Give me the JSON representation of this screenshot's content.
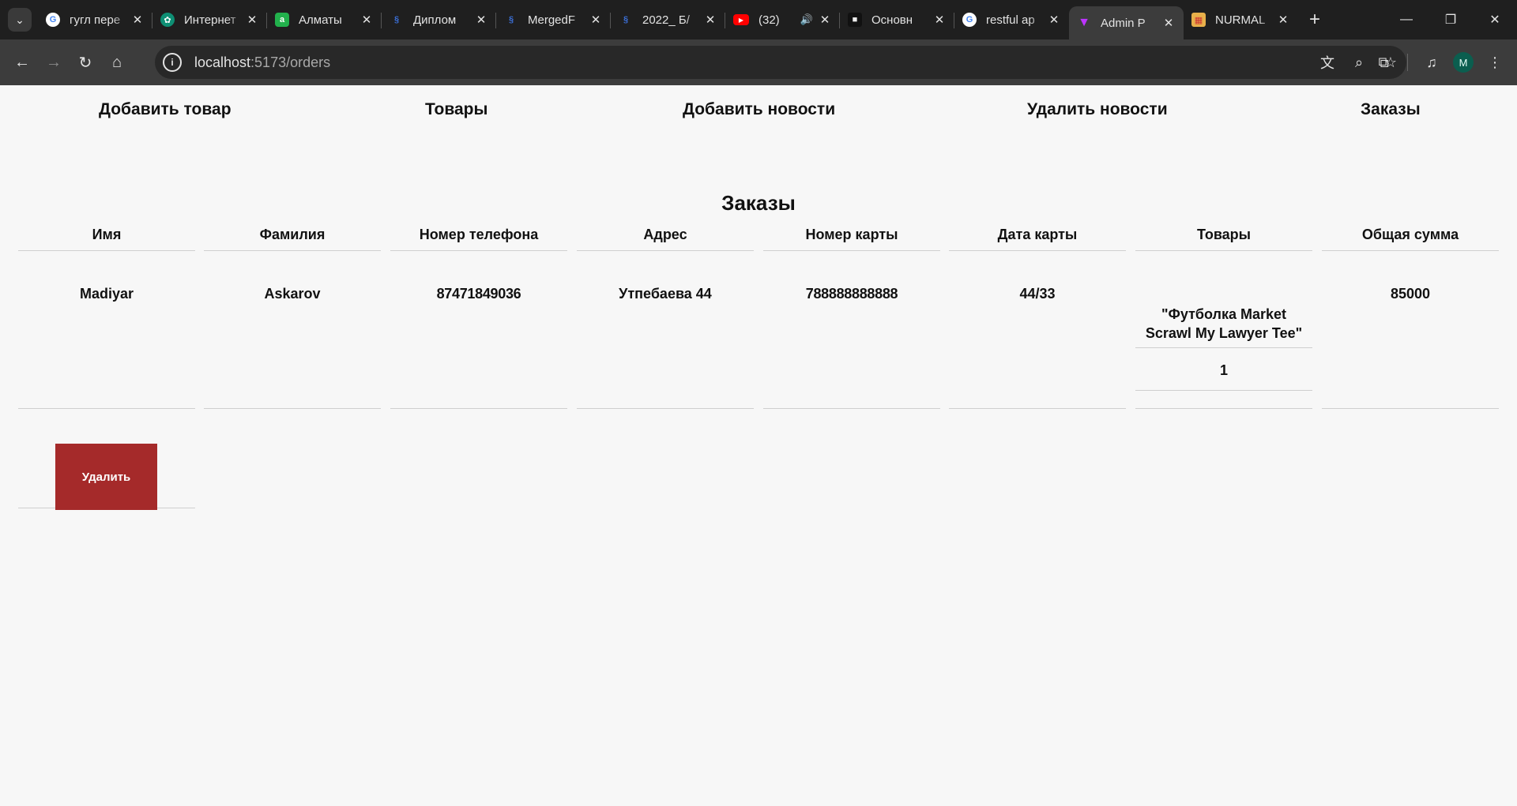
{
  "browser": {
    "tabs": [
      {
        "title": "гугл пере",
        "icon": "google-icon",
        "active": false
      },
      {
        "title": "Интернет",
        "icon": "chatgpt-icon",
        "active": false
      },
      {
        "title": "Алматы",
        "icon": "a-app-icon",
        "active": false
      },
      {
        "title": "Диплом",
        "icon": "docs-icon",
        "active": false
      },
      {
        "title": "MergedF",
        "icon": "docs-icon",
        "active": false
      },
      {
        "title": "2022_ Б/",
        "icon": "docs-icon",
        "active": false
      },
      {
        "title": "(32)",
        "icon": "youtube-icon",
        "active": false,
        "audio": true
      },
      {
        "title": "Основн",
        "icon": "tag-icon",
        "active": false
      },
      {
        "title": "restful ap",
        "icon": "google-icon",
        "active": false
      },
      {
        "title": "Admin P",
        "icon": "vite-icon",
        "active": true
      },
      {
        "title": "NURMAL",
        "icon": "store-icon",
        "active": false
      }
    ],
    "url_host": "localhost",
    "url_path": ":5173/orders",
    "profile_initial": "M"
  },
  "nav": {
    "add_product": "Добавить товар",
    "products": "Товары",
    "add_news": "Добавить новости",
    "delete_news": "Удалить новости",
    "orders": "Заказы"
  },
  "page_title": "Заказы",
  "table": {
    "headers": [
      "Имя",
      "Фамилия",
      "Номер телефона",
      "Адрес",
      "Номер карты",
      "Дата карты",
      "Товары",
      "Общая сумма"
    ],
    "rows": [
      {
        "first_name": "Madiyar",
        "last_name": "Askarov",
        "phone": "87471849036",
        "address": "Утпебаева 44",
        "card_number": "788888888888",
        "card_date": "44/33",
        "product_name": "\"Футболка Market Scrawl My Lawyer Tee\"",
        "product_qty": "1",
        "total": "85000"
      }
    ]
  },
  "delete_label": "Удалить",
  "colors": {
    "delete_button": "#a52a2a",
    "page_bg": "#f7f7f7"
  }
}
